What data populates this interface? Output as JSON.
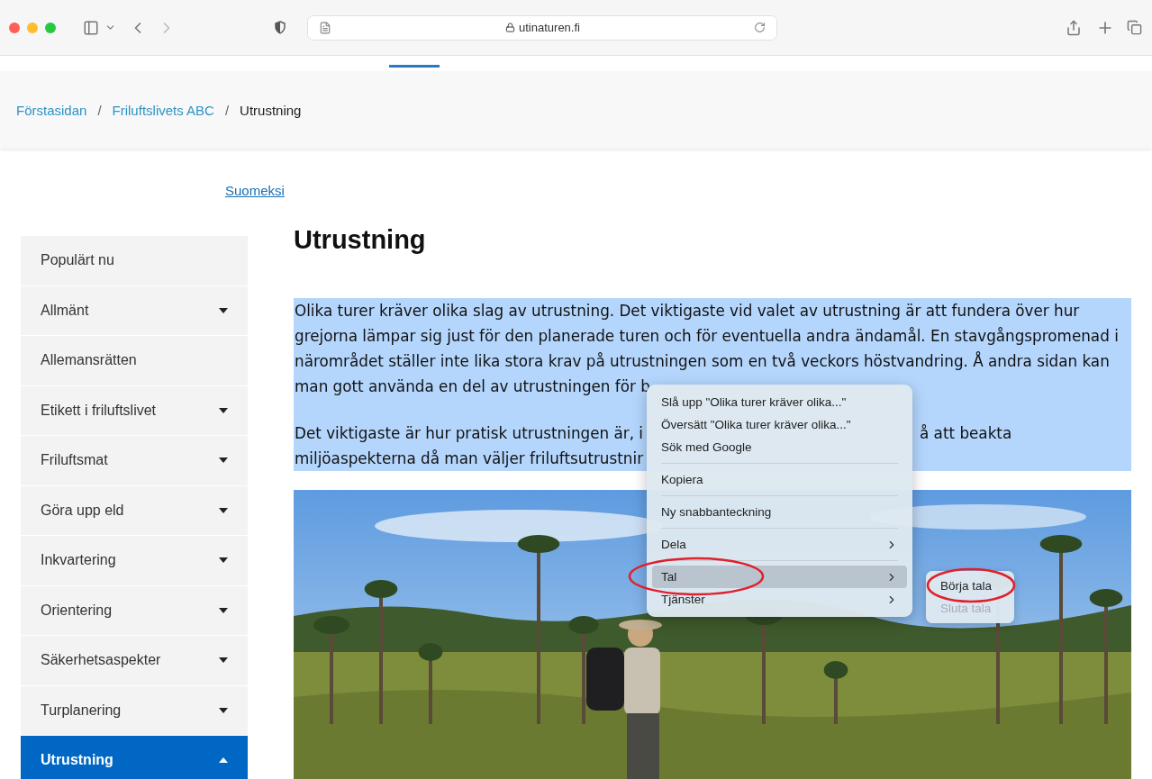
{
  "browser": {
    "url": "utinaturen.fi"
  },
  "breadcrumb": [
    {
      "label": "Förstasidan",
      "kind": "link"
    },
    {
      "label": "Friluftslivets ABC",
      "kind": "link",
      "separator": "/"
    },
    {
      "label": "Utrustning",
      "kind": "current",
      "separator": "/"
    }
  ],
  "language_link": "Suomeksi",
  "sidebar": {
    "items": [
      {
        "label": "Populärt nu",
        "kind": "link",
        "selected": false
      },
      {
        "label": "Allmänt",
        "kind": "menu",
        "expanded": false,
        "selected": false
      },
      {
        "label": "Allemansrätten",
        "kind": "link",
        "selected": false
      },
      {
        "label": "Etikett i friluftslivet",
        "kind": "menu",
        "expanded": false,
        "selected": false
      },
      {
        "label": "Friluftsmat",
        "kind": "menu",
        "expanded": false,
        "selected": false
      },
      {
        "label": "Göra upp eld",
        "kind": "menu",
        "expanded": false,
        "selected": false
      },
      {
        "label": "Inkvartering",
        "kind": "menu",
        "expanded": false,
        "selected": false
      },
      {
        "label": "Orientering",
        "kind": "menu",
        "expanded": false,
        "selected": false
      },
      {
        "label": "Säkerhetsaspekter",
        "kind": "menu",
        "expanded": false,
        "selected": false
      },
      {
        "label": "Turplanering",
        "kind": "menu",
        "expanded": false,
        "selected": false
      },
      {
        "label": "Utrustning",
        "kind": "menu",
        "expanded": true,
        "selected": true
      }
    ]
  },
  "article": {
    "title": "Utrustning",
    "selected": true,
    "paragraphs": [
      {
        "lines": [
          {
            "text": "Olika turer kräver olika slag av utrustning. Det viktigaste vid valet av utrustning är att fundera över hur"
          },
          {
            "text": "grejorna lämpar sig just för den planerade turen och för eventuella andra ändamål. En stavgångspromenad i"
          },
          {
            "text": "närområdet ställer inte lika stora krav på utrustningen som en två veckors höstvandring. Å andra sidan kan"
          },
          {
            "text": "man gott använda en del av utrustningen för b"
          }
        ]
      },
      {
        "lines": [
          {
            "text": "Det viktigaste är hur pratisk utrustningen är, i",
            "after": "å att beakta"
          },
          {
            "text": "miljöaspekterna då man väljer friluftsutrustnir"
          }
        ]
      }
    ]
  },
  "context_menu": {
    "groups": [
      [
        {
          "label": "Slå upp \"Olika turer kräver olika...\"",
          "submenu": false,
          "selected": false,
          "circled": false
        },
        {
          "label": "Översätt \"Olika turer kräver olika...\"",
          "submenu": false,
          "selected": false,
          "circled": false
        },
        {
          "label": "Sök med Google",
          "submenu": false,
          "selected": false,
          "circled": false
        }
      ],
      [
        {
          "label": "Kopiera",
          "submenu": false,
          "selected": false,
          "circled": false
        }
      ],
      [
        {
          "label": "Ny snabbanteckning",
          "submenu": false,
          "selected": false,
          "circled": false
        }
      ],
      [
        {
          "label": "Dela",
          "submenu": true,
          "selected": false,
          "circled": false
        }
      ],
      [
        {
          "label": "Tal",
          "submenu": true,
          "selected": true,
          "circled": true
        },
        {
          "label": "Tjänster",
          "submenu": true,
          "selected": false,
          "circled": false
        }
      ]
    ],
    "submenu": [
      {
        "label": "Börja tala",
        "disabled": false,
        "circled": true
      },
      {
        "label": "Sluta tala",
        "disabled": true,
        "circled": false
      }
    ]
  }
}
